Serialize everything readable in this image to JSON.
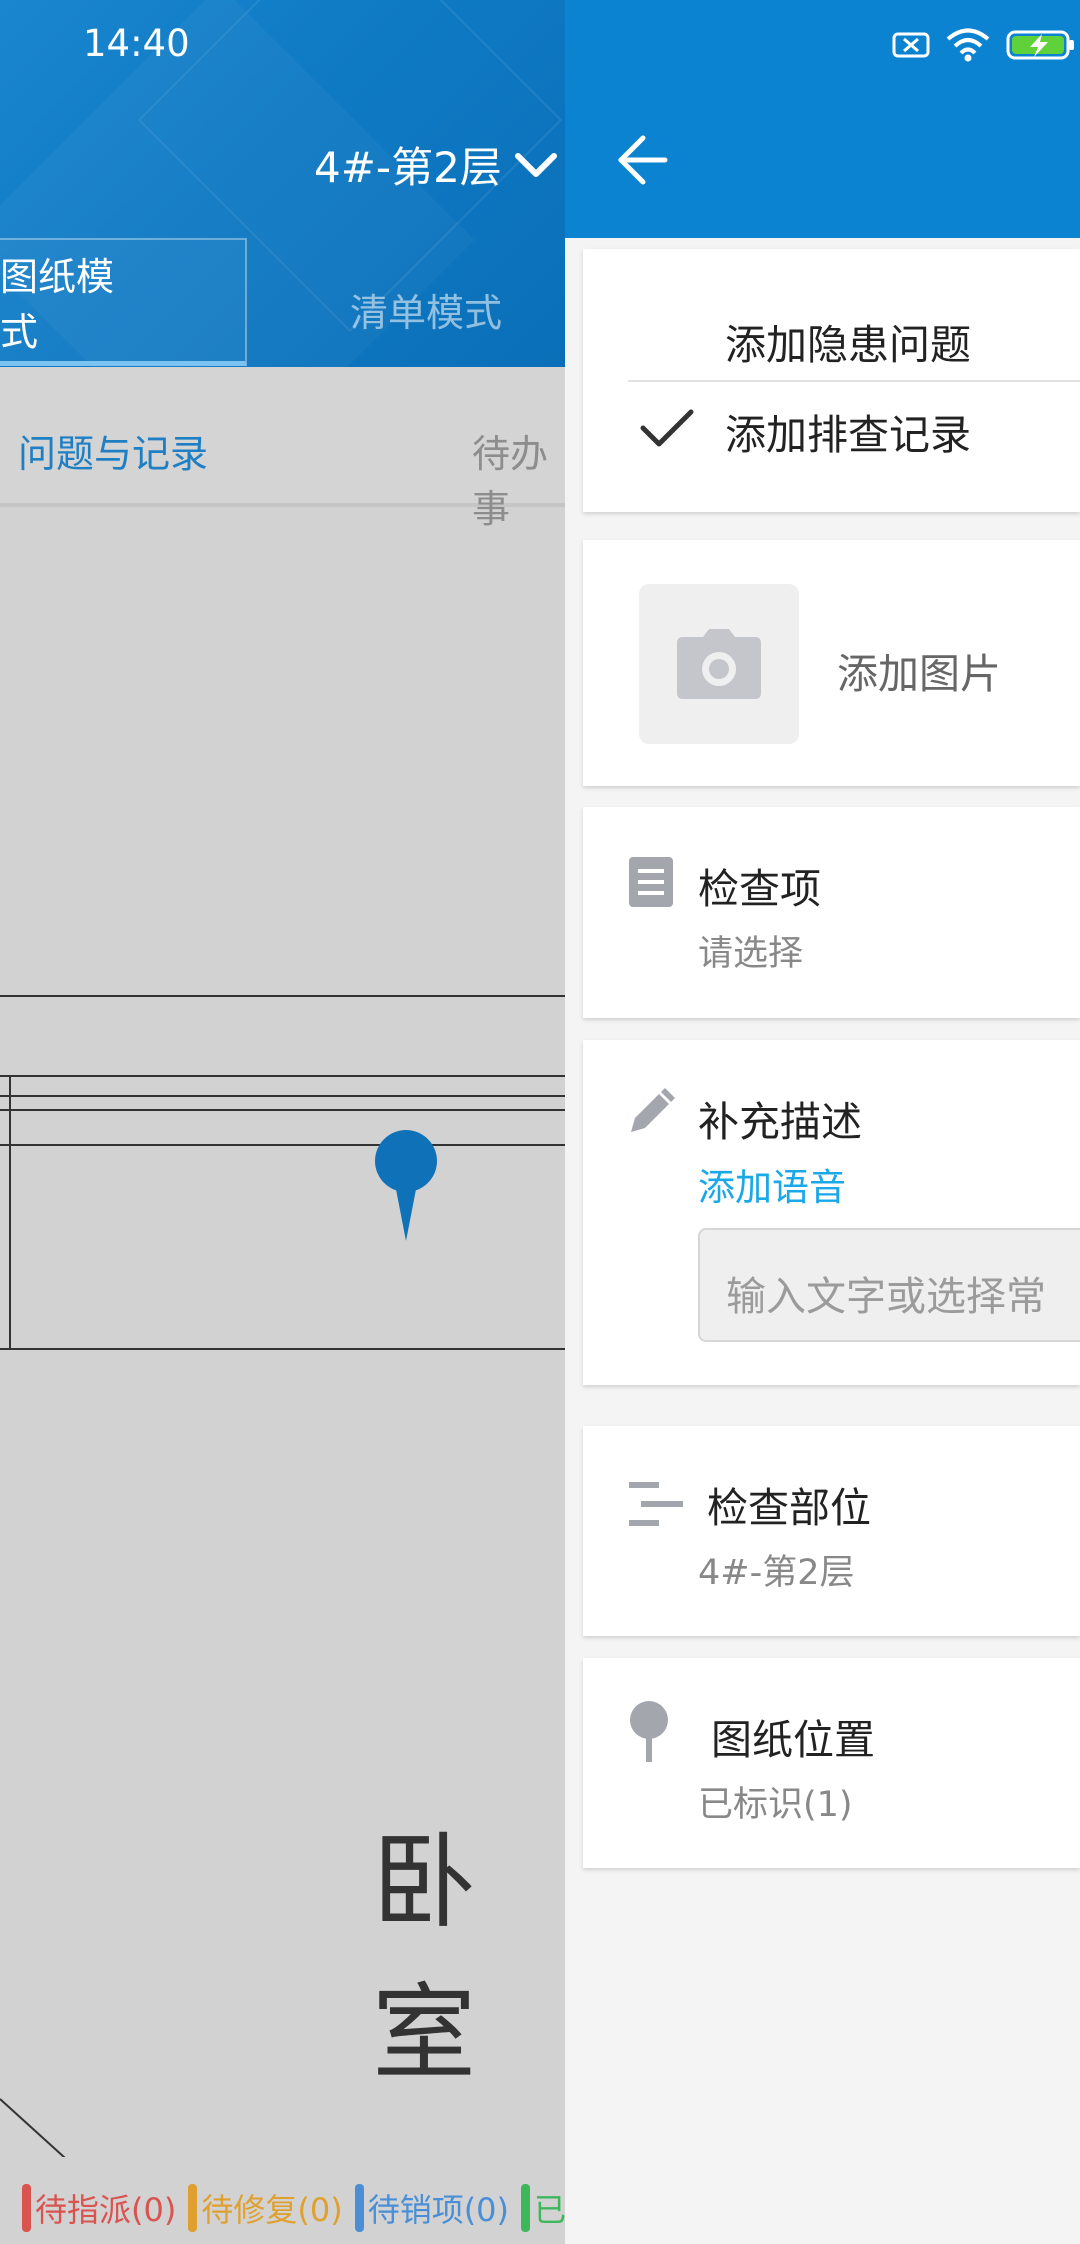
{
  "status_bar": {
    "time": "14:40"
  },
  "background": {
    "floor_selector": "4#-第2层",
    "mode_tabs": [
      "图纸模式",
      "清单模式"
    ],
    "sub_tabs": [
      "问题与记录",
      "待办事"
    ],
    "room_label": "卧室",
    "legend": [
      {
        "label": "待指派(0)",
        "color": "#d9534f"
      },
      {
        "label": "待修复(0)",
        "color": "#e0a030"
      },
      {
        "label": "待销项(0)",
        "color": "#4a8fd6"
      },
      {
        "label": "已",
        "color": "#3cb85a"
      }
    ],
    "pin_color": "#0f72b8"
  },
  "drawer": {
    "accent": "#0b83d0",
    "type_options": [
      {
        "label": "添加隐患问题",
        "selected": false
      },
      {
        "label": "添加排查记录",
        "selected": true
      }
    ],
    "add_photo_label": "添加图片",
    "check_item": {
      "title": "检查项",
      "value": "请选择"
    },
    "description": {
      "title": "补充描述",
      "voice_link": "添加语音",
      "placeholder": "输入文字或选择常"
    },
    "check_location": {
      "title": "检查部位",
      "value": "4#-第2层"
    },
    "drawing_position": {
      "title": "图纸位置",
      "value": "已标识(1)"
    }
  }
}
